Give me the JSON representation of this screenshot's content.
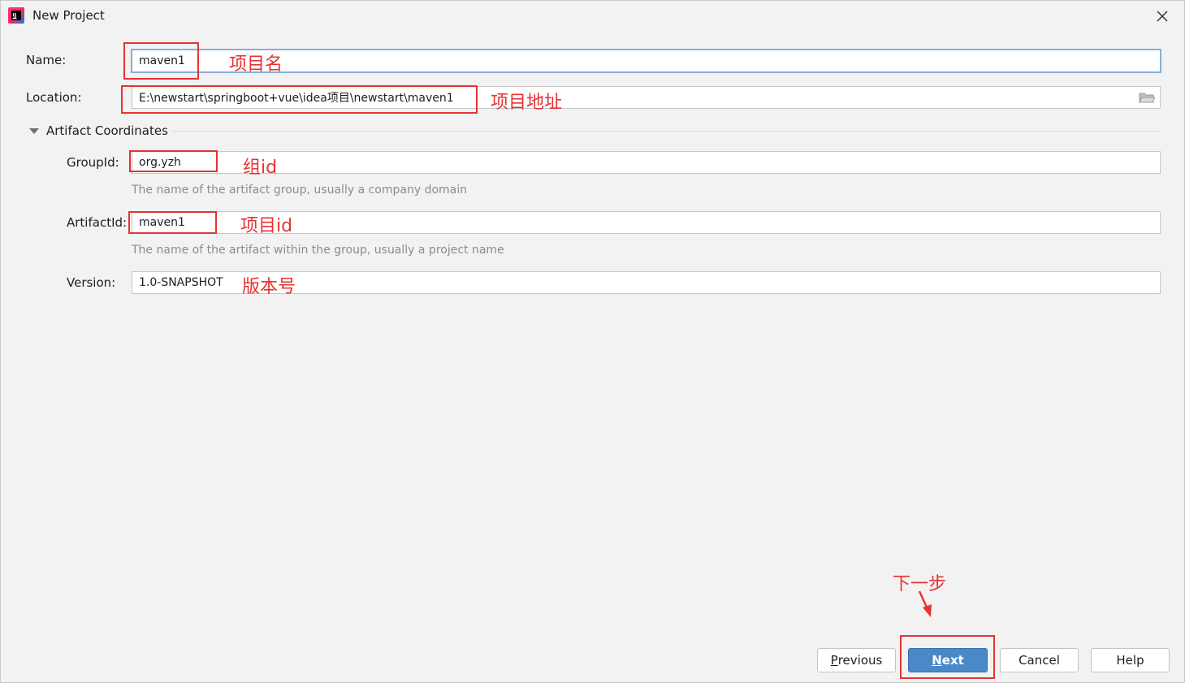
{
  "window": {
    "title": "New Project",
    "app_icon": "intellij-idea-icon",
    "close_icon": "close-icon"
  },
  "form": {
    "name": {
      "label": "Name:",
      "value": "maven1"
    },
    "location": {
      "label": "Location:",
      "value": "E:\\newstart\\springboot+vue\\idea项目\\newstart\\maven1",
      "browse_icon": "folder-open-icon"
    },
    "artifact_section": {
      "label": "Artifact Coordinates",
      "expanded": true
    },
    "group_id": {
      "label": "GroupId:",
      "value": "org.yzh",
      "hint": "The name of the artifact group, usually a company domain"
    },
    "artifact_id": {
      "label": "ArtifactId:",
      "value": "maven1",
      "hint": "The name of the artifact within the group, usually a project name"
    },
    "version": {
      "label": "Version:",
      "value": "1.0-SNAPSHOT"
    }
  },
  "annotations": {
    "name": "项目名",
    "location": "项目地址",
    "group_id": "组id",
    "artifact_id": "项目id",
    "version": "版本号",
    "next": "下一步",
    "color": "#e53333"
  },
  "buttons": {
    "previous": {
      "mnemonic": "P",
      "rest": "revious"
    },
    "next": {
      "mnemonic": "N",
      "rest": "ext"
    },
    "cancel": "Cancel",
    "help": "Help"
  },
  "colors": {
    "background": "#f2f2f2",
    "primary_button": "#4a88c7",
    "focus_border": "#87afda"
  }
}
